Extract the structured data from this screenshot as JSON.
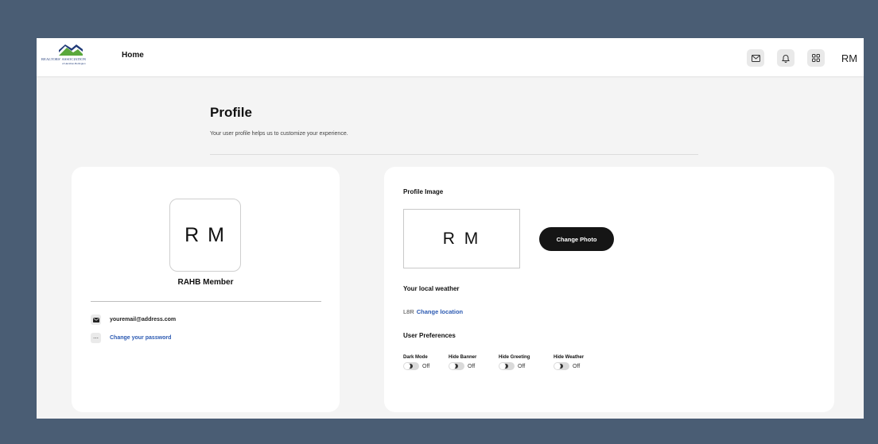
{
  "header": {
    "logo_text": "REALTORS' ASSOCIATION",
    "logo_sub": "of Hamilton-Burlington",
    "nav_home": "Home",
    "avatar_initials": "RM",
    "icons": [
      "mail-icon",
      "bell-icon",
      "apps-icon"
    ]
  },
  "page": {
    "title": "Profile",
    "subtitle": "Your user profile helps us to customize your experience."
  },
  "left_card": {
    "avatar_initials": "R M",
    "member_name": "RAHB Member",
    "email": "youremail@address.com",
    "change_password": "Change your password"
  },
  "right_card": {
    "profile_image_label": "Profile Image",
    "image_initials": "R M",
    "change_photo": "Change Photo",
    "weather_label": "Your local weather",
    "postal_code": "L8R",
    "change_location": "Change location",
    "preferences_label": "User Preferences",
    "preferences": [
      {
        "label": "Dark Mode",
        "state": "Off",
        "on": false
      },
      {
        "label": "Hide Banner",
        "state": "Off",
        "on": false
      },
      {
        "label": "Hide Greeting",
        "state": "Off",
        "on": false
      },
      {
        "label": "Hide Weather",
        "state": "Off",
        "on": false
      }
    ]
  },
  "colors": {
    "backdrop": "#4a5d74",
    "link": "#2c5ab2",
    "button": "#151515",
    "logo_blue": "#203a78",
    "logo_green": "#5aa83c"
  }
}
